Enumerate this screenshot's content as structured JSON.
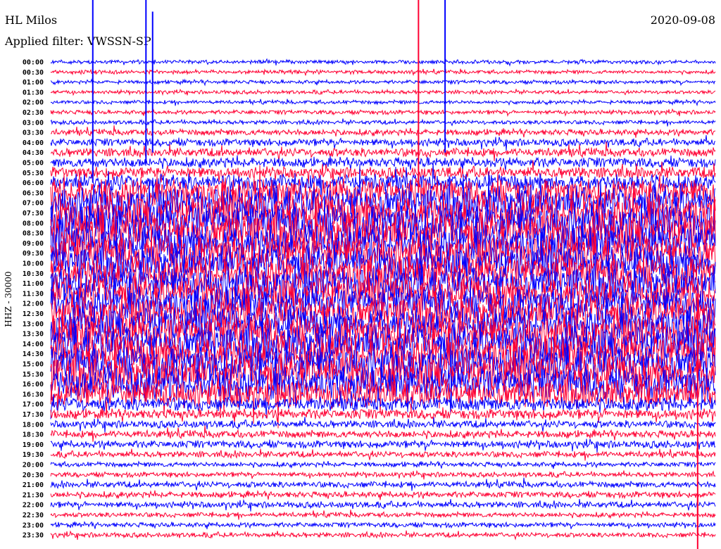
{
  "header": {
    "station": "HL Milos",
    "date": "2020-09-08",
    "filter": "Applied filter: VWSSN-SP"
  },
  "chart_data": {
    "type": "line",
    "subtype": "helicorder",
    "title": "HL Milos",
    "ylabel": "HHZ - 30000",
    "minutes_per_line": 30,
    "colors": [
      "#0000ff",
      "#ff0033"
    ],
    "yticks": [
      "00:00",
      "00:30",
      "01:00",
      "01:30",
      "02:00",
      "02:30",
      "03:00",
      "03:30",
      "04:00",
      "04:30",
      "05:00",
      "05:30",
      "06:00",
      "06:30",
      "07:00",
      "07:30",
      "08:00",
      "08:30",
      "09:00",
      "09:30",
      "10:00",
      "10:30",
      "11:00",
      "11:30",
      "12:00",
      "12:30",
      "13:00",
      "13:30",
      "14:00",
      "14:30",
      "15:00",
      "15:30",
      "16:00",
      "16:30",
      "17:00",
      "17:30",
      "18:00",
      "18:30",
      "19:00",
      "19:30",
      "20:00",
      "20:30",
      "21:00",
      "21:30",
      "22:00",
      "22:30",
      "23:00",
      "23:30"
    ],
    "relative_amplitude": [
      0.1,
      0.1,
      0.1,
      0.1,
      0.1,
      0.12,
      0.12,
      0.2,
      0.25,
      0.3,
      0.35,
      0.4,
      0.6,
      1.0,
      1.2,
      1.3,
      1.4,
      1.4,
      1.3,
      1.3,
      1.2,
      1.2,
      1.2,
      1.2,
      1.2,
      1.2,
      1.2,
      1.3,
      1.3,
      1.3,
      1.3,
      1.3,
      1.2,
      1.0,
      0.5,
      0.35,
      0.25,
      0.25,
      0.25,
      0.2,
      0.15,
      0.15,
      0.2,
      0.2,
      0.2,
      0.15,
      0.15,
      0.15
    ],
    "events": [
      {
        "line": 0,
        "minute": 1.9,
        "amplitude": 12
      },
      {
        "line": 0,
        "minute": 4.3,
        "amplitude": 10
      },
      {
        "line": 0,
        "minute": 17.8,
        "amplitude": 9
      },
      {
        "line": 2,
        "minute": 4.6,
        "amplitude": 7
      },
      {
        "line": 3,
        "minute": 16.6,
        "amplitude": 10
      },
      {
        "line": 35,
        "minute": 29.2,
        "amplitude": 12
      },
      {
        "line": 47,
        "minute": 29.2,
        "amplitude": 4
      }
    ]
  }
}
